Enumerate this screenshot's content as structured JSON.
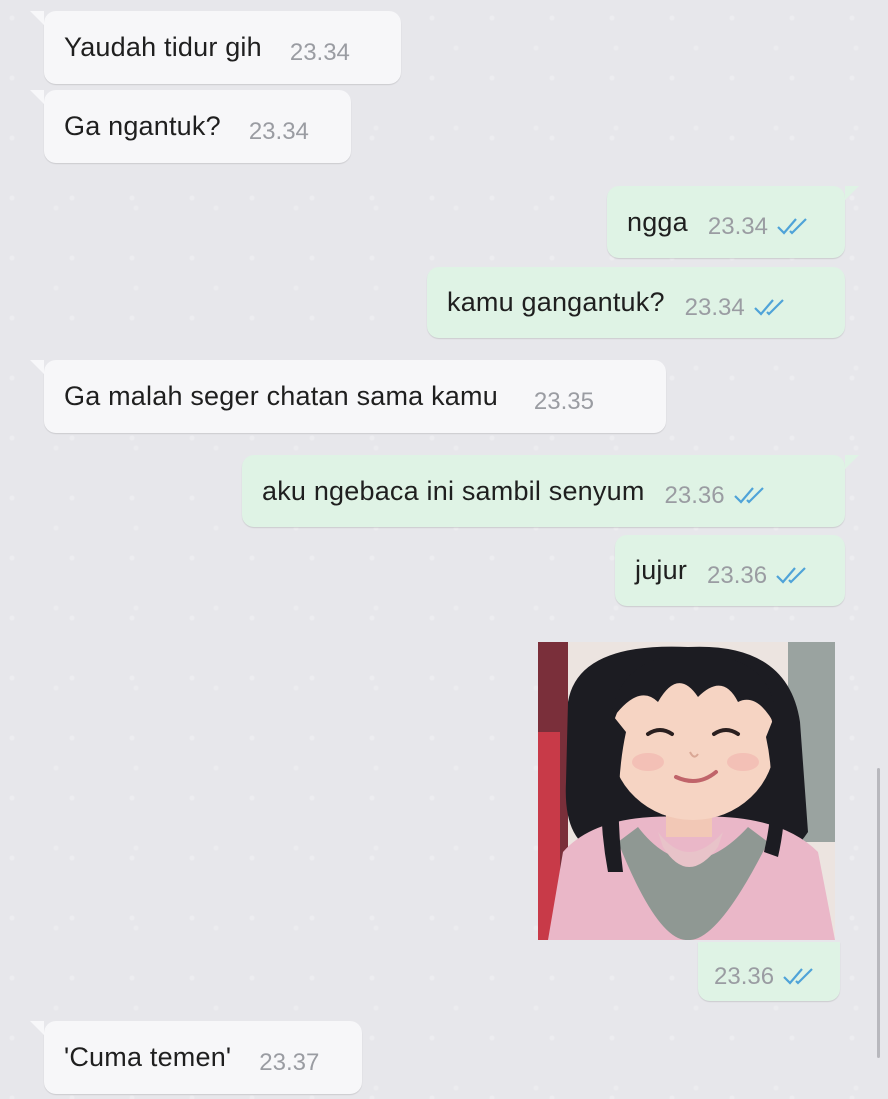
{
  "messages": [
    {
      "direction": "incoming",
      "text": "Yaudah tidur gih",
      "time": "23.34"
    },
    {
      "direction": "incoming",
      "text": "Ga ngantuk?",
      "time": "23.34"
    },
    {
      "direction": "outgoing",
      "text": "ngga",
      "time": "23.34",
      "status": "read"
    },
    {
      "direction": "outgoing",
      "text": "kamu gangantuk?",
      "time": "23.34",
      "status": "read"
    },
    {
      "direction": "incoming",
      "text": "Ga malah seger chatan sama kamu",
      "time": "23.35"
    },
    {
      "direction": "outgoing",
      "text": "aku ngebaca ini sambil senyum",
      "time": "23.36",
      "status": "read"
    },
    {
      "direction": "outgoing",
      "text": "jujur",
      "time": "23.36",
      "status": "read"
    },
    {
      "direction": "outgoing",
      "type": "image",
      "image": "smiling-girl-photo",
      "time": "23.36",
      "status": "read"
    },
    {
      "direction": "incoming",
      "text": "'Cuma temen'",
      "time": "23.37"
    }
  ],
  "colors": {
    "background": "#e7e7eb",
    "incoming_bubble": "#f7f7f9",
    "outgoing_bubble": "#dff3e5",
    "timestamp": "#9a9ca2",
    "read_ticks": "#4fa3d8"
  },
  "icons": {
    "read_receipt": "double-check-icon"
  }
}
